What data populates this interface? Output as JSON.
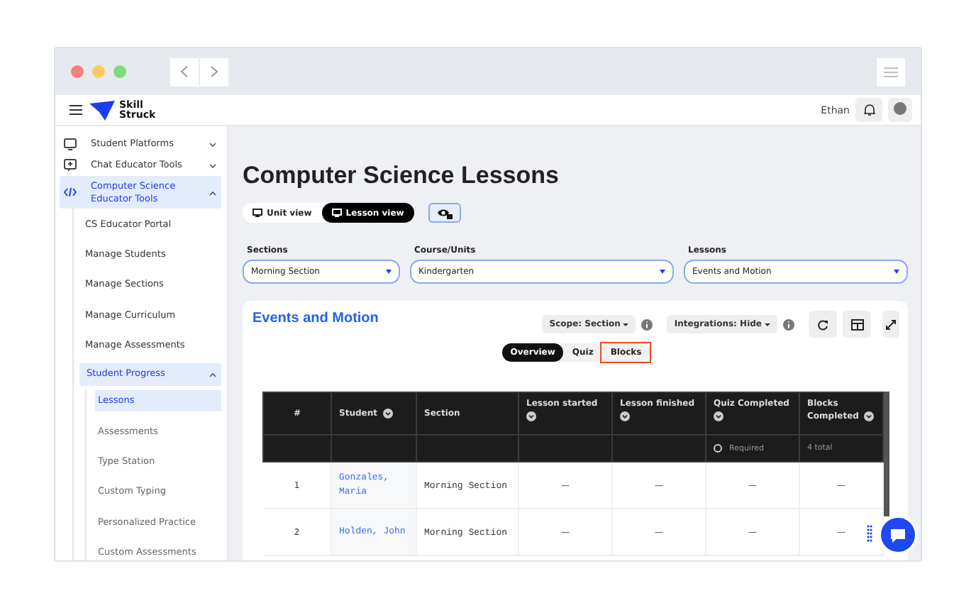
{
  "header": {
    "logo_text": "Skill Struck",
    "user_name": "Ethan"
  },
  "sidebar": {
    "items": [
      {
        "label": "Student Platforms",
        "expanded": false,
        "selected": false
      },
      {
        "label": "Chat Educator Tools",
        "expanded": false,
        "selected": false
      },
      {
        "label": "Computer Science Educator Tools",
        "expanded": true,
        "selected": true,
        "children": [
          {
            "label": "CS Educator Portal",
            "selected": false
          },
          {
            "label": "Manage Students",
            "selected": false
          },
          {
            "label": "Manage Sections",
            "selected": false
          },
          {
            "label": "Manage Curriculum",
            "selected": false
          },
          {
            "label": "Manage Assessments",
            "selected": false
          },
          {
            "label": "Student Progress",
            "expanded": true,
            "selected": true,
            "children": [
              {
                "label": "Lessons",
                "selected": true
              },
              {
                "label": "Assessments",
                "selected": false
              },
              {
                "label": "Type Station",
                "selected": false
              },
              {
                "label": "Custom Typing",
                "selected": false
              },
              {
                "label": "Personalized Practice",
                "selected": false
              },
              {
                "label": "Custom Assessments",
                "selected": false
              }
            ]
          }
        ]
      }
    ]
  },
  "main": {
    "title": "Computer Science Lessons",
    "view_toggle": [
      {
        "label": "Unit view",
        "selected": false
      },
      {
        "label": "Lesson view",
        "selected": true
      }
    ],
    "filters": [
      {
        "label": "Sections",
        "value": "Morning Section"
      },
      {
        "label": "Course/Units",
        "value": "Kindergarten"
      },
      {
        "label": "Lessons",
        "value": "Events and Motion"
      }
    ],
    "card": {
      "title": "Events and Motion",
      "scope": "Scope: Section",
      "integrations": "Integrations: Hide",
      "tabs": [
        {
          "label": "Overview",
          "selected": true,
          "highlighted": false
        },
        {
          "label": "Quiz",
          "selected": false,
          "highlighted": false
        },
        {
          "label": "Blocks",
          "selected": false,
          "highlighted": true
        }
      ],
      "table": {
        "columns": [
          {
            "label": "#",
            "sortable": false
          },
          {
            "label": "Student",
            "sortable": true
          },
          {
            "label": "Section",
            "sortable": false
          },
          {
            "label": "Lesson started",
            "sortable": true
          },
          {
            "label": "Lesson finished",
            "sortable": true
          },
          {
            "label": "Quiz Completed",
            "sortable": true,
            "note": "Required"
          },
          {
            "label": "Blocks Completed",
            "sortable": true,
            "note": "4 total"
          }
        ],
        "rows": [
          {
            "number": "1",
            "student": "Gonzales, Maria",
            "section": "Morning Section",
            "lesson_started": "—",
            "lesson_finished": "—",
            "quiz_completed": "—",
            "blocks_completed": "—"
          },
          {
            "number": "2",
            "student": "Holden, John",
            "section": "Morning Section",
            "lesson_started": "—",
            "lesson_finished": "—",
            "quiz_completed": "—",
            "blocks_completed": "—"
          }
        ]
      }
    }
  }
}
